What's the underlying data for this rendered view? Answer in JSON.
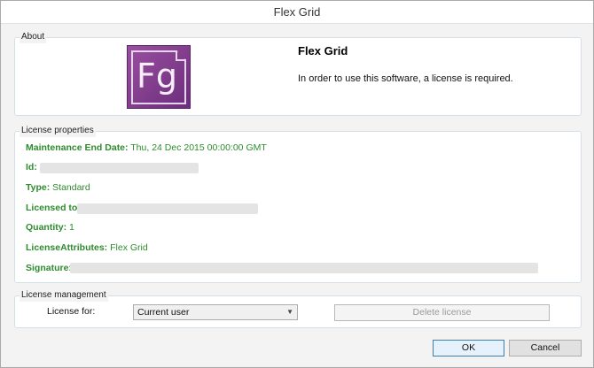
{
  "window": {
    "title": "Flex Grid"
  },
  "about": {
    "legend": "About",
    "logo_text": "Fg",
    "title": "Flex Grid",
    "message": "In order to use this software, a license is required."
  },
  "properties": {
    "legend": "License properties",
    "maintenance_label": "Maintenance End Date:",
    "maintenance_value": "Thu, 24 Dec 2015 00:00:00 GMT",
    "id_label": "Id:",
    "type_label": "Type:",
    "type_value": "Standard",
    "licensed_to_label": "Licensed to:",
    "quantity_label": "Quantity:",
    "quantity_value": "1",
    "attributes_label": "LicenseAttributes:",
    "attributes_value": "Flex Grid",
    "signature_label": "Signature:"
  },
  "management": {
    "legend": "License management",
    "license_for_label": "License for:",
    "license_for_value": "Current user",
    "delete_label": "Delete license"
  },
  "buttons": {
    "ok": "OK",
    "cancel": "Cancel"
  },
  "colors": {
    "accent_green": "#2e8b2e",
    "logo_purple": "#7b3a8c"
  }
}
